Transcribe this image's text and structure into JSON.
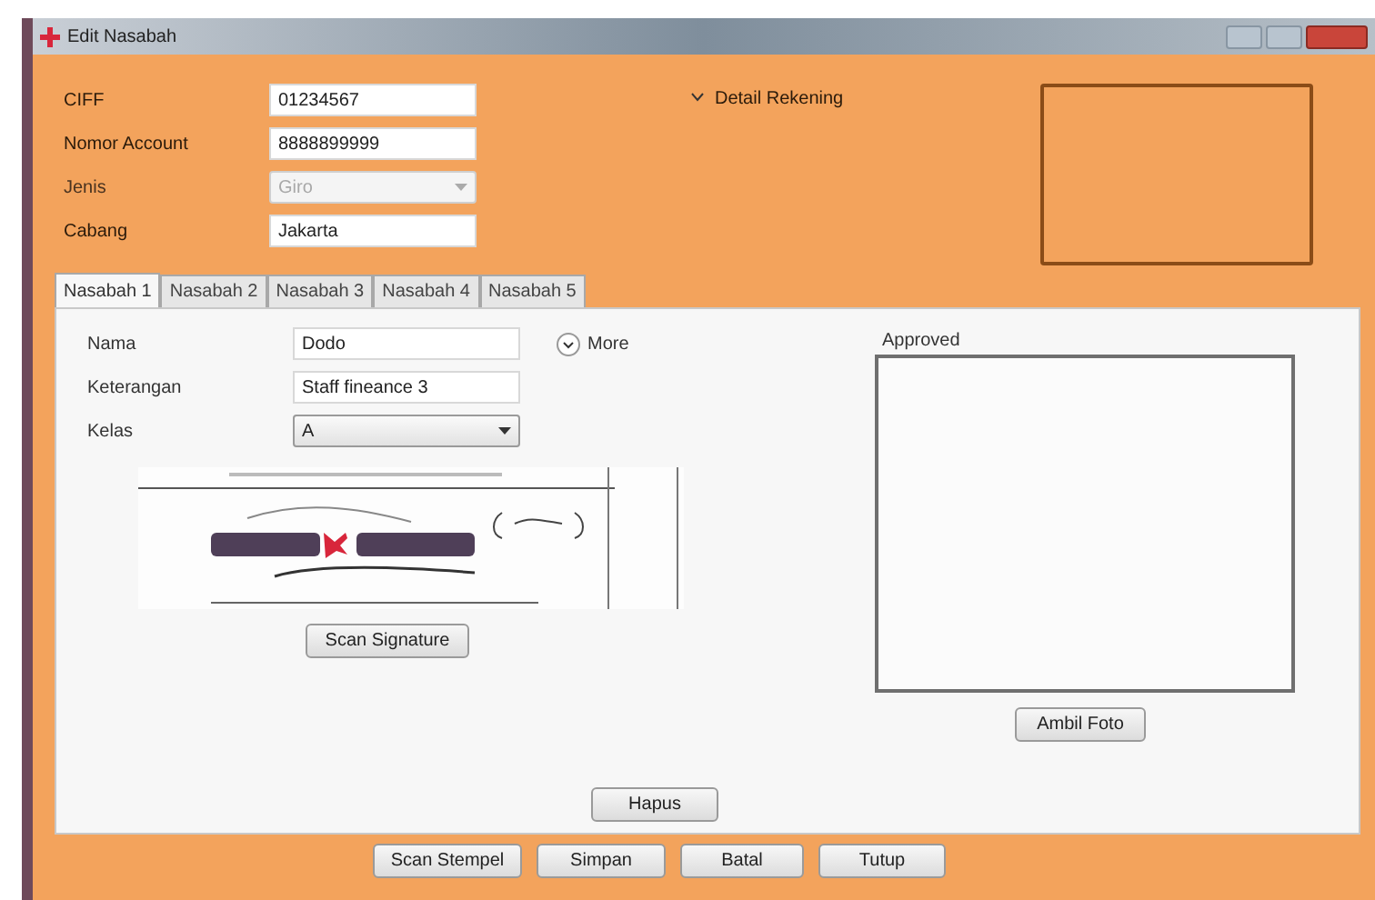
{
  "window": {
    "title": "Edit Nasabah"
  },
  "header_fields": [
    {
      "label": "CIFF",
      "value": "01234567",
      "kind": "text",
      "disabled": false
    },
    {
      "label": "Nomor Account",
      "value": "8888899999",
      "kind": "text",
      "disabled": false
    },
    {
      "label": "Jenis",
      "value": "Giro",
      "kind": "select",
      "disabled": true
    },
    {
      "label": "Cabang",
      "value": "Jakarta",
      "kind": "text",
      "disabled": false
    }
  ],
  "detail_toggle": {
    "label": "Detail Rekening"
  },
  "tabs": [
    {
      "label": "Nasabah 1",
      "selected": true
    },
    {
      "label": "Nasabah 2",
      "selected": false
    },
    {
      "label": "Nasabah 3",
      "selected": false
    },
    {
      "label": "Nasabah 4",
      "selected": false
    },
    {
      "label": "Nasabah 5",
      "selected": false
    }
  ],
  "nasabah_fields": [
    {
      "label": "Nama",
      "value": "Dodo",
      "kind": "text"
    },
    {
      "label": "Keterangan",
      "value": "Staff fineance 3",
      "kind": "text"
    },
    {
      "label": "Kelas",
      "value": "A",
      "kind": "select"
    }
  ],
  "more_toggle": {
    "label": "More"
  },
  "signature": {
    "kind": "picture",
    "button": "Scan Signature"
  },
  "photo": {
    "label": "Approved",
    "button": "Ambil Foto"
  },
  "delete_button": "Hapus",
  "footer_buttons": [
    "Scan Stempel",
    "Simpan",
    "Batal",
    "Tutup"
  ]
}
